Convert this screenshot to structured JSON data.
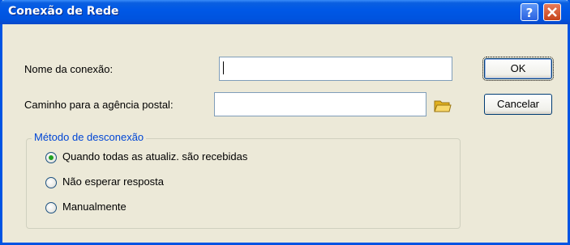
{
  "window": {
    "title": "Conexão de Rede"
  },
  "fields": {
    "connection_name": {
      "label": "Nome da conexão:",
      "value": ""
    },
    "post_office_path": {
      "label": "Caminho para a agência postal:",
      "value": ""
    }
  },
  "buttons": {
    "ok": "OK",
    "cancel": "Cancelar"
  },
  "disconnect_method": {
    "title": "Método de desconexão",
    "options": [
      {
        "label": "Quando todas as atualiz. são recebidas",
        "checked": true
      },
      {
        "label": "Não esperar resposta",
        "checked": false
      },
      {
        "label": "Manualmente",
        "checked": false
      }
    ]
  },
  "colors": {
    "titlebar": "#0058e6",
    "dialog_bg": "#ece9d8",
    "group_title": "#0046d5",
    "radio_dot": "#21a121"
  },
  "icons": {
    "help": "help-icon",
    "close": "close-icon",
    "browse": "folder-icon"
  }
}
